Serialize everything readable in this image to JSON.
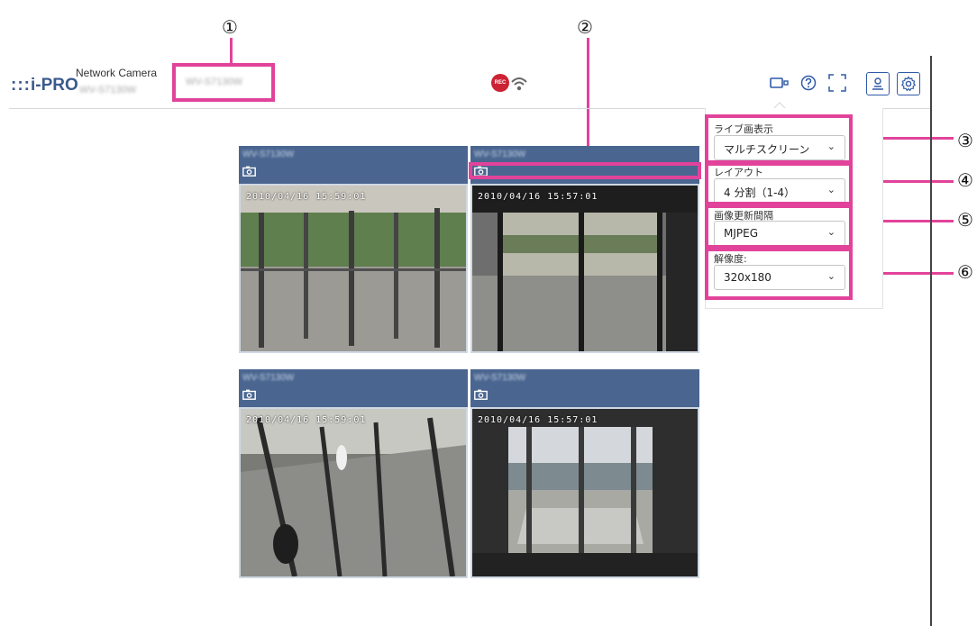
{
  "header": {
    "logo_text": "i-PRO",
    "logo_dots": ":::",
    "product_line": "Network Camera",
    "model_blurred": "WV-S7130W",
    "camera_title_blurred": "WV-S7130W",
    "rec_badge": "REC"
  },
  "callouts": [
    "①",
    "②",
    "③",
    "④",
    "⑤",
    "⑥"
  ],
  "cameras": [
    {
      "title": "WV-S7130W",
      "timestamp": "2010/04/16 15:59:01"
    },
    {
      "title": "WV-S7130W",
      "timestamp": "2010/04/16 15:57:01"
    },
    {
      "title": "WV-S7130W",
      "timestamp": "2010/04/16 15:59:01"
    },
    {
      "title": "WV-S7130W",
      "timestamp": "2010/04/16 15:57:01"
    }
  ],
  "panel": {
    "live_display": {
      "label": "ライブ画表示",
      "value": "マルチスクリーン"
    },
    "layout": {
      "label": "レイアウト",
      "value": "4 分割（1-4）"
    },
    "refresh": {
      "label": "画像更新間隔",
      "value": "MJPEG"
    },
    "resolution": {
      "label": "解像度:",
      "value": "320x180"
    }
  },
  "colors": {
    "accent": "#e2439a",
    "tile_header": "#4a6690",
    "logo": "#3a5a8c",
    "rec": "#cc2233"
  },
  "icons": [
    "camera-icon",
    "help-icon",
    "fullscreen-icon",
    "user-icon",
    "gear-icon",
    "wifi-icon",
    "snapshot-icon"
  ]
}
